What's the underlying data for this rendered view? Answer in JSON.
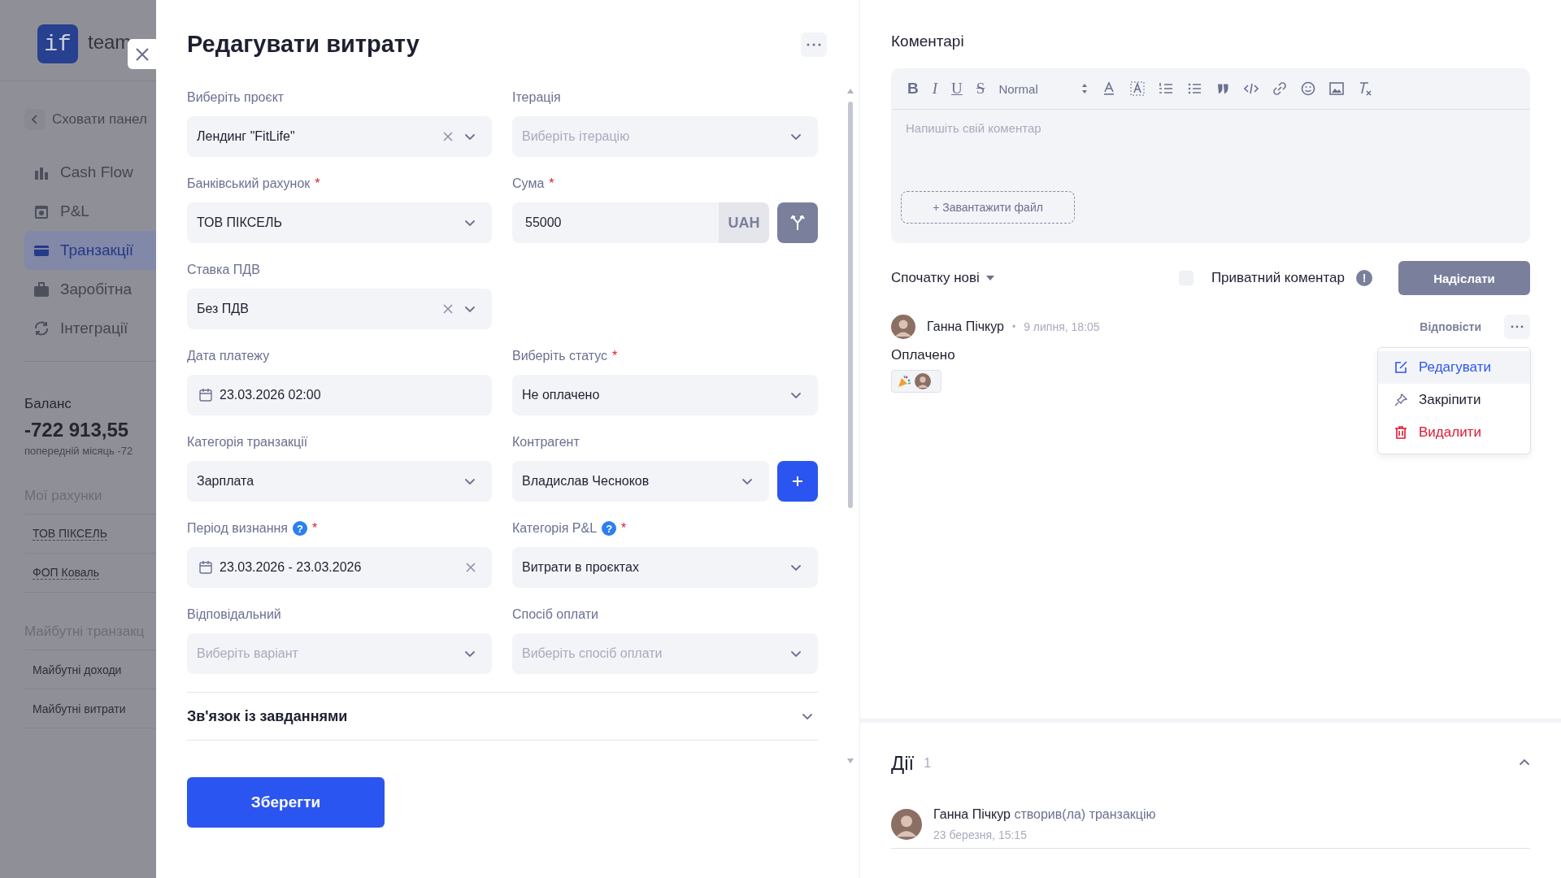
{
  "sidebar": {
    "logo": "if",
    "brand": "team",
    "collapse": "Сховати панел",
    "nav": [
      {
        "kind": "cashflow",
        "label": "Cash Flow",
        "selected": false
      },
      {
        "kind": "pnl",
        "label": "P&L",
        "selected": false
      },
      {
        "kind": "transactions",
        "label": "Транзакції",
        "selected": true
      },
      {
        "kind": "salary",
        "label": "Заробітна",
        "selected": false
      },
      {
        "kind": "integrations",
        "label": "Інтеграції",
        "selected": false
      }
    ],
    "balance": {
      "label": "Баланс",
      "amount": "-722 913,55",
      "previous": "попередній місяць -72"
    },
    "accounts": {
      "title": "Мої рахунки",
      "items": [
        "ТОВ ПІКСЕЛЬ",
        "ФОП Коваль"
      ]
    },
    "future": {
      "title": "Майбутні транзакц",
      "items": [
        "Майбутні доходи",
        "Майбутні витрати"
      ]
    }
  },
  "form": {
    "title": "Редагувати витрату",
    "rows": [
      [
        {
          "kind": "select",
          "label": "Виберіть проєкт",
          "value": "Лендинг \"FitLife\"",
          "clearable": true
        },
        {
          "kind": "select",
          "label": "Ітерація",
          "placeholder": "Виберіть ітерацію",
          "clearable": false
        }
      ],
      [
        {
          "kind": "select",
          "label": "Банківський рахунок",
          "required_mark": "*",
          "value": "ТОВ ПІКСЕЛЬ",
          "clearable": false
        },
        {
          "kind": "amount",
          "label": "Сума",
          "required_mark": "*",
          "value": "55000",
          "currency": "UAH"
        }
      ],
      [
        {
          "kind": "select",
          "label": "Ставка ПДВ",
          "value": "Без ПДВ",
          "clearable": true
        }
      ],
      [
        {
          "kind": "date",
          "label": "Дата платежу",
          "value": "23.03.2026 02:00"
        },
        {
          "kind": "select",
          "label": "Виберіть статус",
          "required_mark": "*",
          "value": "Не оплачено",
          "clearable": false
        }
      ],
      [
        {
          "kind": "select",
          "label": "Категорія транзакції",
          "value": "Зарплата",
          "clearable": false
        },
        {
          "kind": "counterparty",
          "label": "Контрагент",
          "value": "Владислав Чесноков"
        }
      ],
      [
        {
          "kind": "daterange",
          "label": "Період визнання",
          "help": "?",
          "required_mark": "*",
          "value": "23.03.2026 - 23.03.2026"
        },
        {
          "kind": "select",
          "label": "Категорія P&L",
          "help": "?",
          "required_mark": "*",
          "value": "Витрати в проєктах",
          "clearable": false
        }
      ],
      [
        {
          "kind": "select",
          "label": "Відповідальний",
          "placeholder": "Виберіть варіант",
          "clearable": false
        },
        {
          "kind": "select",
          "label": "Спосіб оплати",
          "placeholder": "Виберіть спосіб оплати",
          "clearable": false
        }
      ]
    ],
    "sections": [
      {
        "title": "Зв'язок із завданнями",
        "expanded": false
      }
    ],
    "save": "Зберегти"
  },
  "comments": {
    "title": "Коментарі",
    "toolbar": [
      {
        "kind": "bold",
        "label": "B"
      },
      {
        "kind": "italic",
        "label": "I"
      },
      {
        "kind": "underline",
        "label": "U"
      },
      {
        "kind": "strike",
        "label": "S"
      },
      {
        "kind": "size",
        "label": "Normal"
      },
      {
        "kind": "color"
      },
      {
        "kind": "background"
      },
      {
        "kind": "ordered"
      },
      {
        "kind": "bullet"
      },
      {
        "kind": "quote"
      },
      {
        "kind": "code"
      },
      {
        "kind": "link"
      },
      {
        "kind": "emoji"
      },
      {
        "kind": "image"
      },
      {
        "kind": "clean"
      }
    ],
    "placeholder": "Напишіть свій коментар",
    "upload": "+ Завантажити файл",
    "sort": "Спочатку нові",
    "private": {
      "label": "Приватний коментар",
      "checked": false,
      "info": "!"
    },
    "send": "Надіслати",
    "items": [
      {
        "author": "Ганна Пічкур",
        "separator": "•",
        "time": "9 липня, 18:05",
        "reply": "Відповісти",
        "text": "Оплачено",
        "reactions": [
          {
            "kind": "party"
          }
        ],
        "menu": [
          {
            "kind": "edit",
            "label": "Редагувати",
            "selected": true
          },
          {
            "kind": "pin",
            "label": "Закріпити",
            "selected": false
          },
          {
            "kind": "delete",
            "label": "Видалити",
            "selected": false
          }
        ]
      }
    ]
  },
  "actions": {
    "title": "Дії",
    "count": "1",
    "expanded": true,
    "items": [
      {
        "author": "Ганна Пічкур",
        "text": "створив(ла) транзакцію",
        "time": "23 березня, 15:15"
      }
    ]
  }
}
